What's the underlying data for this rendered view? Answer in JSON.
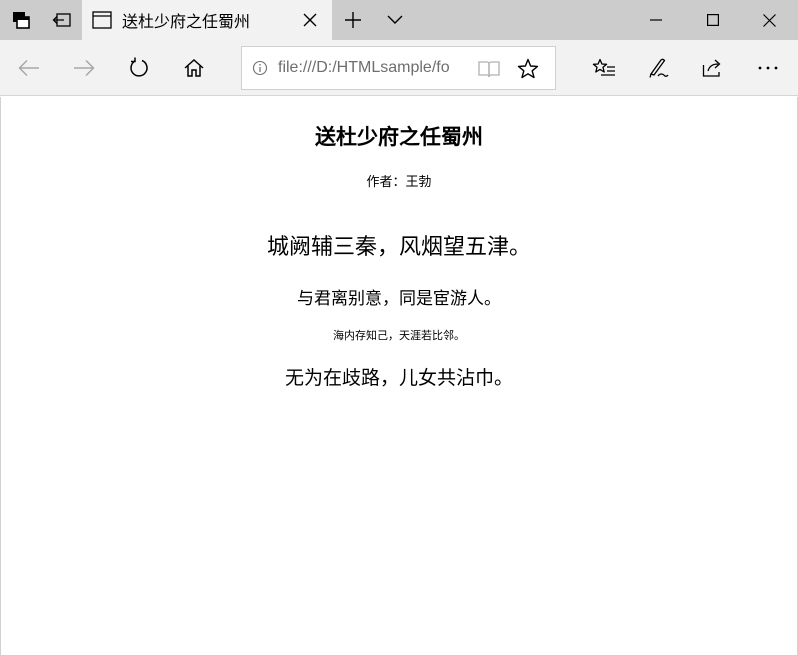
{
  "tab": {
    "title": "送杜少府之任蜀州"
  },
  "address": {
    "url": "file:///D:/HTMLsample/fo"
  },
  "page": {
    "title": "送杜少府之任蜀州",
    "author": "作者：王勃",
    "lines": [
      "城阙辅三秦，风烟望五津。",
      "与君离别意，同是宦游人。",
      "海内存知己，天涯若比邻。",
      "无为在歧路，儿女共沾巾。"
    ]
  },
  "icons": {
    "set_tabs_aside": "tabs-stack-icon",
    "show_tabs_aside": "tabs-aside-icon",
    "tab_page": "page-icon",
    "tab_close": "close-icon",
    "new_tab": "plus-icon",
    "tab_preview": "chevron-down-icon",
    "minimize": "minimize-icon",
    "maximize": "maximize-icon",
    "close": "close-icon",
    "back": "back-arrow-icon",
    "forward": "forward-arrow-icon",
    "refresh": "refresh-icon",
    "home": "home-icon",
    "info": "info-icon",
    "reading_view": "book-icon",
    "favorite": "star-icon",
    "favorites_hub": "favorites-list-icon",
    "web_note": "pen-icon",
    "share": "share-icon",
    "more": "more-icon"
  }
}
